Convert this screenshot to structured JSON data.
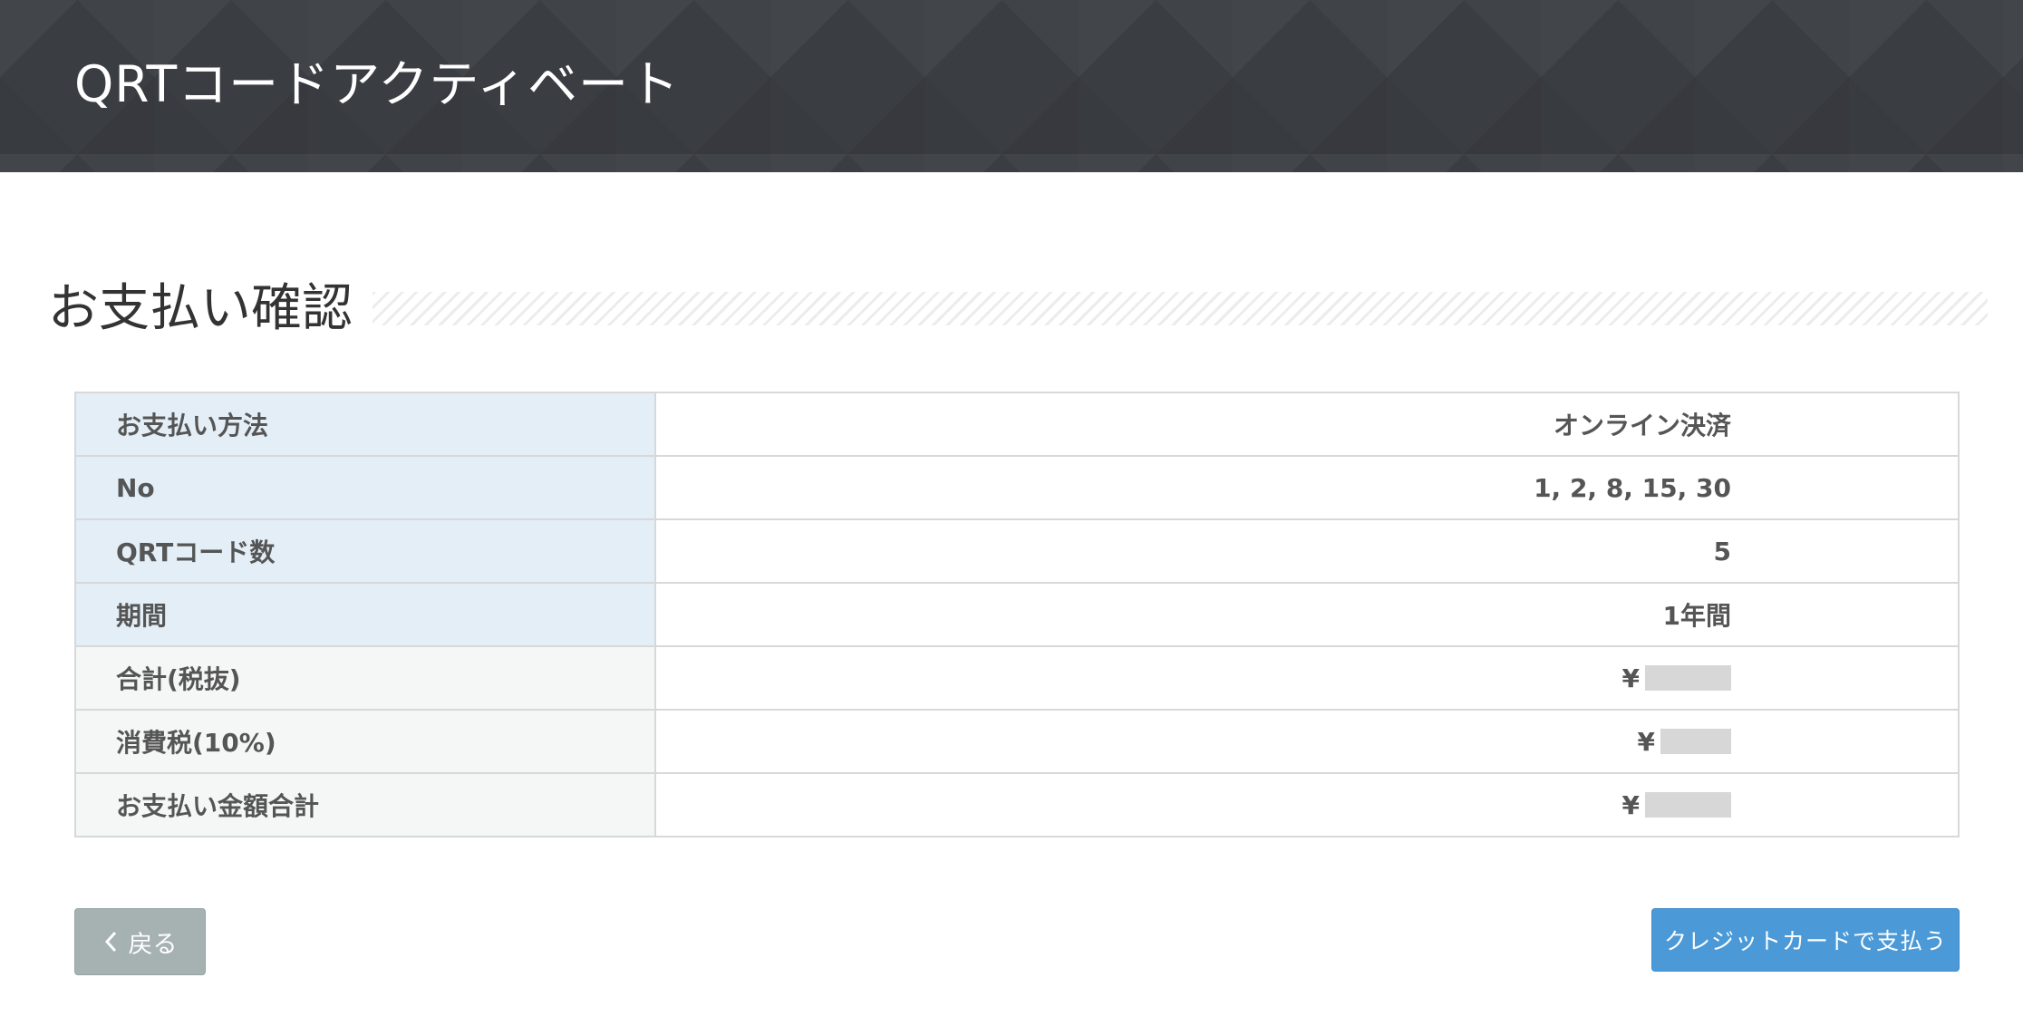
{
  "header": {
    "title": "QRTコードアクティベート"
  },
  "section": {
    "title": "お支払い確認"
  },
  "table": {
    "rows": [
      {
        "label": "お支払い方法",
        "value": "オンライン決済"
      },
      {
        "label": "No",
        "value": "1, 2, 8, 15, 30"
      },
      {
        "label": "QRTコード数",
        "value": "5"
      },
      {
        "label": "期間",
        "value": "1年間"
      },
      {
        "label": "合計(税抜)",
        "currency": "¥"
      },
      {
        "label": "消費税(10%)",
        "currency": "¥"
      },
      {
        "label": "お支払い金額合計",
        "currency": "¥"
      }
    ]
  },
  "buttons": {
    "back_label": "戻る",
    "pay_label": "クレジットカードで支払う"
  },
  "colors": {
    "header_bg": "#3a3d42",
    "label_blue_bg": "#e3eef7",
    "label_gray_bg": "#f5f7f6",
    "back_button_bg": "#a6b1b2",
    "pay_button_bg": "#4b9ad7"
  }
}
